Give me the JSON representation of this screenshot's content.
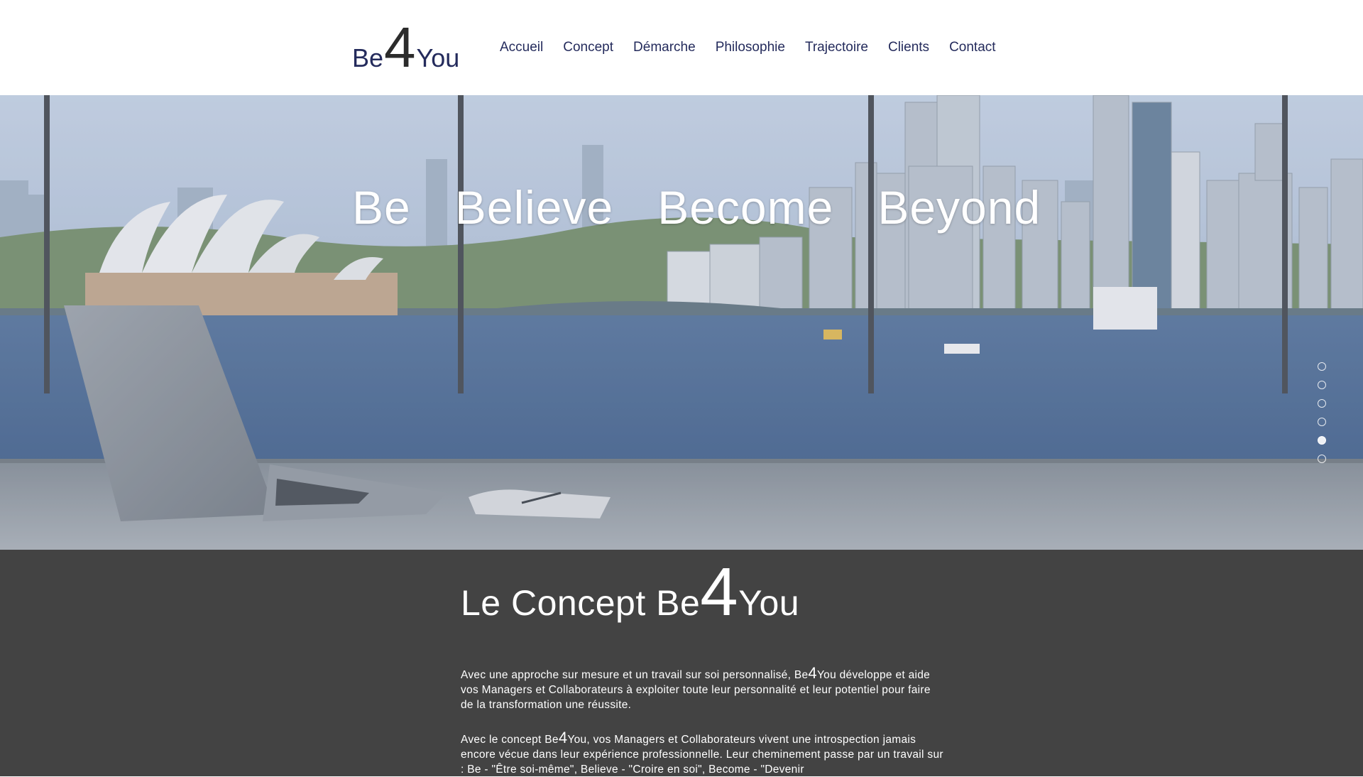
{
  "brand": {
    "pre": "Be",
    "num": "4",
    "post": "You"
  },
  "nav": {
    "items": [
      {
        "label": "Accueil"
      },
      {
        "label": "Concept"
      },
      {
        "label": "Démarche"
      },
      {
        "label": "Philosophie"
      },
      {
        "label": "Trajectoire"
      },
      {
        "label": "Clients"
      },
      {
        "label": "Contact"
      }
    ]
  },
  "hero": {
    "words": [
      "Be",
      "Believe",
      "Become",
      "Beyond"
    ]
  },
  "concept": {
    "title_prefix": "Le Concept Be",
    "title_num": "4",
    "title_suffix": "You",
    "p1_a": "Avec une approche sur mesure et un travail sur soi personnalisé, Be",
    "p1_num": "4",
    "p1_b": "You développe et aide vos Managers et Collaborateurs à exploiter toute leur personnalité et leur potentiel pour faire de la transformation une réussite.",
    "p2_a": "Avec le concept Be",
    "p2_num": "4",
    "p2_b": "You, vos Managers et Collaborateurs vivent une introspection jamais encore vécue dans leur expérience professionnelle. Leur cheminement passe par un travail sur : Be - \"Être soi-même\", Believe - \"Croire en soi\", Become - \"Devenir"
  }
}
